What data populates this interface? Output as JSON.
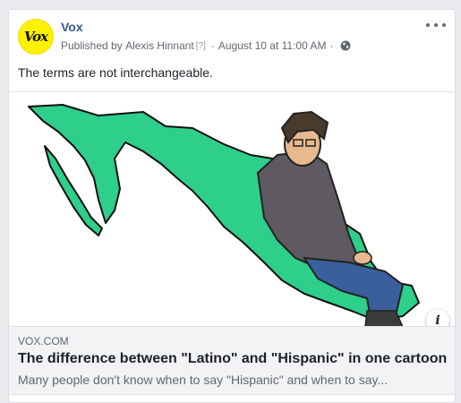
{
  "post": {
    "avatar_text": "Vox",
    "page_name": "Vox",
    "published_by_prefix": "Published by",
    "author": "Alexis Hinnant",
    "help_marker": "[?]",
    "separator": "·",
    "timestamp": "August 10 at 11:00 AM",
    "audience_icon": "globe-icon",
    "more_icon": "more-options-icon",
    "message": "The terms are not interchangeable."
  },
  "link_preview": {
    "domain": "VOX.COM",
    "title": "The difference between \"Latino\" and \"Hispanic\" in one cartoon",
    "description": "Many people don't know when to say \"Hispanic\" and when to say...",
    "info_label": "i"
  },
  "colors": {
    "brand_yellow": "#fff200",
    "link_blue": "#385898",
    "map_green": "#2ecf8a"
  }
}
